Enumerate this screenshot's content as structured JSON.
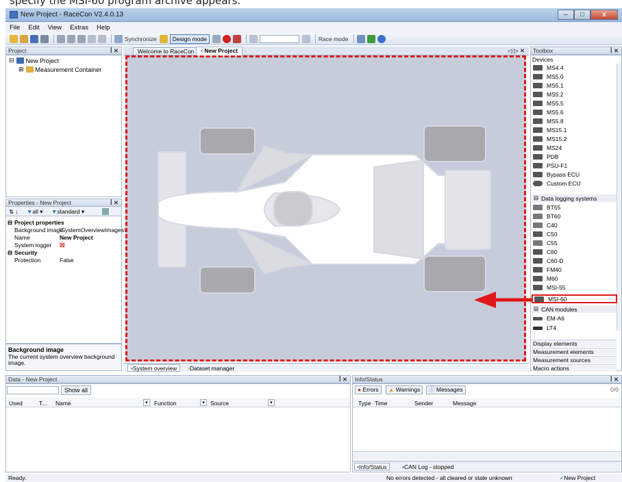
{
  "caption": "specify the MSI-60 program archive appears.",
  "window": {
    "title": "New Project - RaceCon V2.4.0.13",
    "min": "–",
    "max": "□",
    "close": "x"
  },
  "menu": [
    "File",
    "Edit",
    "View",
    "Extras",
    "Help"
  ],
  "toolbar": {
    "synchronize": "Synchronize",
    "design_mode": "Design mode",
    "race_mode": "Race mode"
  },
  "project_panel": {
    "title": "Project",
    "pin": "ꟾ ✕",
    "root": "New Project",
    "child": "Measurement Container"
  },
  "properties_panel": {
    "title": "Properties - New Project",
    "filter_all": "all",
    "filter_standard": "standard",
    "sections": [
      {
        "name": "Project properties"
      },
      {
        "name": "Security"
      }
    ],
    "rows": {
      "background_key": "Background image",
      "background_val": "\\SystemOverviewImages\\",
      "name_key": "Name",
      "name_val": "New Project",
      "logger_key": "System logger",
      "protection_key": "Protection",
      "protection_val": "False"
    },
    "desc_title": "Background image",
    "desc_text": "The current system overview background image."
  },
  "doc_tabs": {
    "welcome": "Welcome to RaceCon",
    "project": "New Project",
    "nav": "◁ ▷ ✕"
  },
  "bottom_tabs": {
    "overview": "System overview",
    "dataset": "Dataset manager"
  },
  "toolbox": {
    "title": "Toolbox",
    "devices_label": "Devices",
    "devices": [
      "MS4.4",
      "MS5.0",
      "MS5.1",
      "MS5.2",
      "MS5.5",
      "MS5.6",
      "MS5.8",
      "MS15.1",
      "MS15.2",
      "MS24",
      "PDB",
      "PSU-F1",
      "Bypass ECU",
      "Custom ECU"
    ],
    "logging_group": "Data logging systems",
    "logging": [
      "BT55",
      "BT60",
      "C40",
      "C50",
      "C55",
      "C60",
      "C60-D",
      "FM40",
      "M60",
      "MSI-55",
      "MSI-60"
    ],
    "can_group": "CAN modules",
    "can": [
      "EM-A6",
      "LT4"
    ],
    "footer": [
      "Display elements",
      "Measurement elements",
      "Measurement sources",
      "Macro actions"
    ],
    "highlight_color": "#e01818"
  },
  "data_panel": {
    "title": "Data - New Project",
    "show_all": "Show all",
    "cols": {
      "used": "Used",
      "t": "T...",
      "name": "Name",
      "function": "Function",
      "source": "Source"
    }
  },
  "info_panel": {
    "title": "Info/Status",
    "errors": "Errors",
    "warnings": "Warnings",
    "messages": "Messages",
    "count": "0/0",
    "cols": {
      "type": "Type",
      "time": "Time",
      "sender": "Sender",
      "message": "Message"
    },
    "tab_info": "Info/Status",
    "tab_can": "CAN Log - stopped"
  },
  "status": {
    "left": "Ready.",
    "center": "No errors detected - all cleared or state unknown",
    "right": "New Project"
  }
}
